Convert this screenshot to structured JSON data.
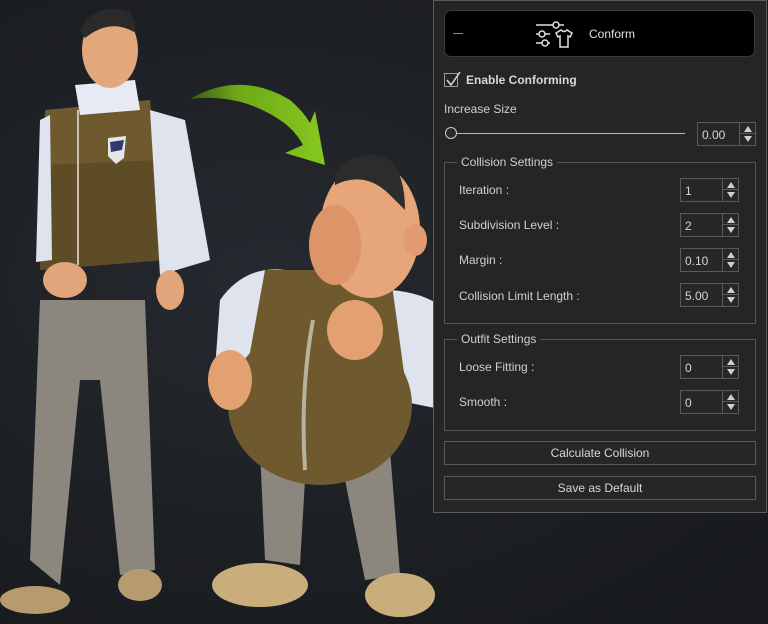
{
  "panel": {
    "header": {
      "title": "Conform",
      "collapse_icon": "minus-icon",
      "icon": "sliders-shirt-icon"
    },
    "enable_conforming": {
      "label": "Enable Conforming",
      "checked": true
    },
    "increase_size": {
      "label": "Increase Size",
      "value": "0.00",
      "slider_fraction": 0.0
    },
    "collision_settings": {
      "title": "Collision Settings",
      "fields": [
        {
          "label": "Iteration :",
          "value": "1"
        },
        {
          "label": "Subdivision Level :",
          "value": "2"
        },
        {
          "label": "Margin :",
          "value": "0.10"
        },
        {
          "label": "Collision Limit Length :",
          "value": "5.00"
        }
      ]
    },
    "outfit_settings": {
      "title": "Outfit Settings",
      "fields": [
        {
          "label": "Loose Fitting :",
          "value": "0"
        },
        {
          "label": "Smooth :",
          "value": "0"
        }
      ]
    },
    "buttons": {
      "calculate": "Calculate Collision",
      "save_default": "Save as Default"
    }
  },
  "scene": {
    "arrow_color": "#7fbf1a",
    "description": "Tall realistic character transforming into stylized cartoon character"
  }
}
